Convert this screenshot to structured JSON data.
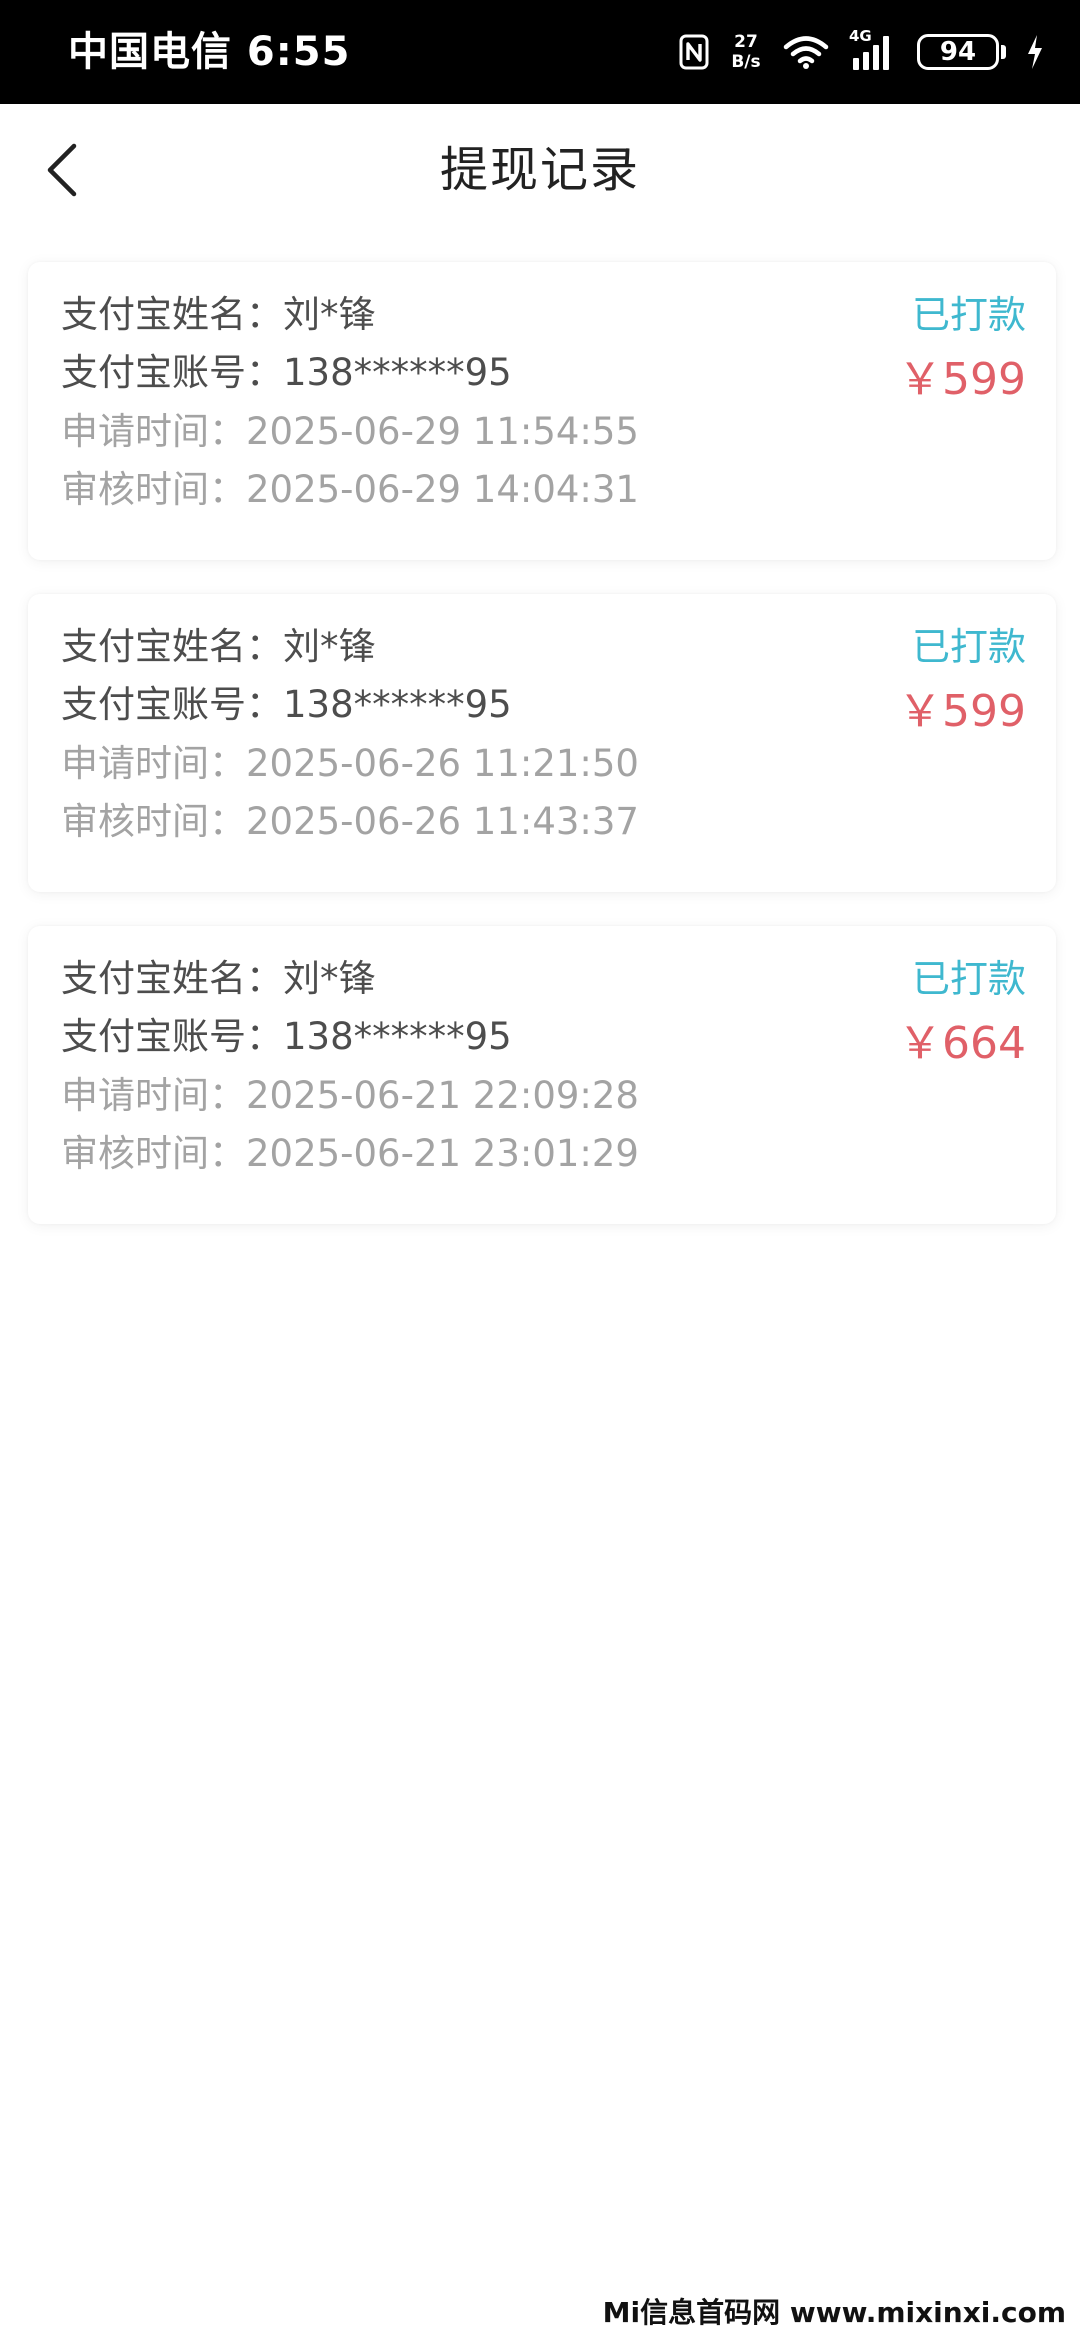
{
  "status_bar": {
    "carrier_time": "中国电信 6:55",
    "net_speed_value": "27",
    "net_speed_unit": "B/s",
    "network_type": "4G",
    "battery_level": "94"
  },
  "header": {
    "title": "提现记录",
    "back_icon": "chevron-left-icon"
  },
  "colors": {
    "status_paid": "#3fb8cf",
    "amount": "#e06068"
  },
  "records": [
    {
      "name_label": "支付宝姓名：",
      "name": "刘*锋",
      "account_label": "支付宝账号：",
      "account": "138******95",
      "apply_label": "申请时间：",
      "apply_time": "2025-06-29 11:54:55",
      "review_label": "审核时间：",
      "review_time": "2025-06-29 14:04:31",
      "status": "已打款",
      "amount": "￥599"
    },
    {
      "name_label": "支付宝姓名：",
      "name": "刘*锋",
      "account_label": "支付宝账号：",
      "account": "138******95",
      "apply_label": "申请时间：",
      "apply_time": "2025-06-26 11:21:50",
      "review_label": "审核时间：",
      "review_time": "2025-06-26 11:43:37",
      "status": "已打款",
      "amount": "￥599"
    },
    {
      "name_label": "支付宝姓名：",
      "name": "刘*锋",
      "account_label": "支付宝账号：",
      "account": "138******95",
      "apply_label": "申请时间：",
      "apply_time": "2025-06-21 22:09:28",
      "review_label": "审核时间：",
      "review_time": "2025-06-21 23:01:29",
      "status": "已打款",
      "amount": "￥664"
    }
  ],
  "watermark": "Mi信息首码网 www.mixinxi.com"
}
